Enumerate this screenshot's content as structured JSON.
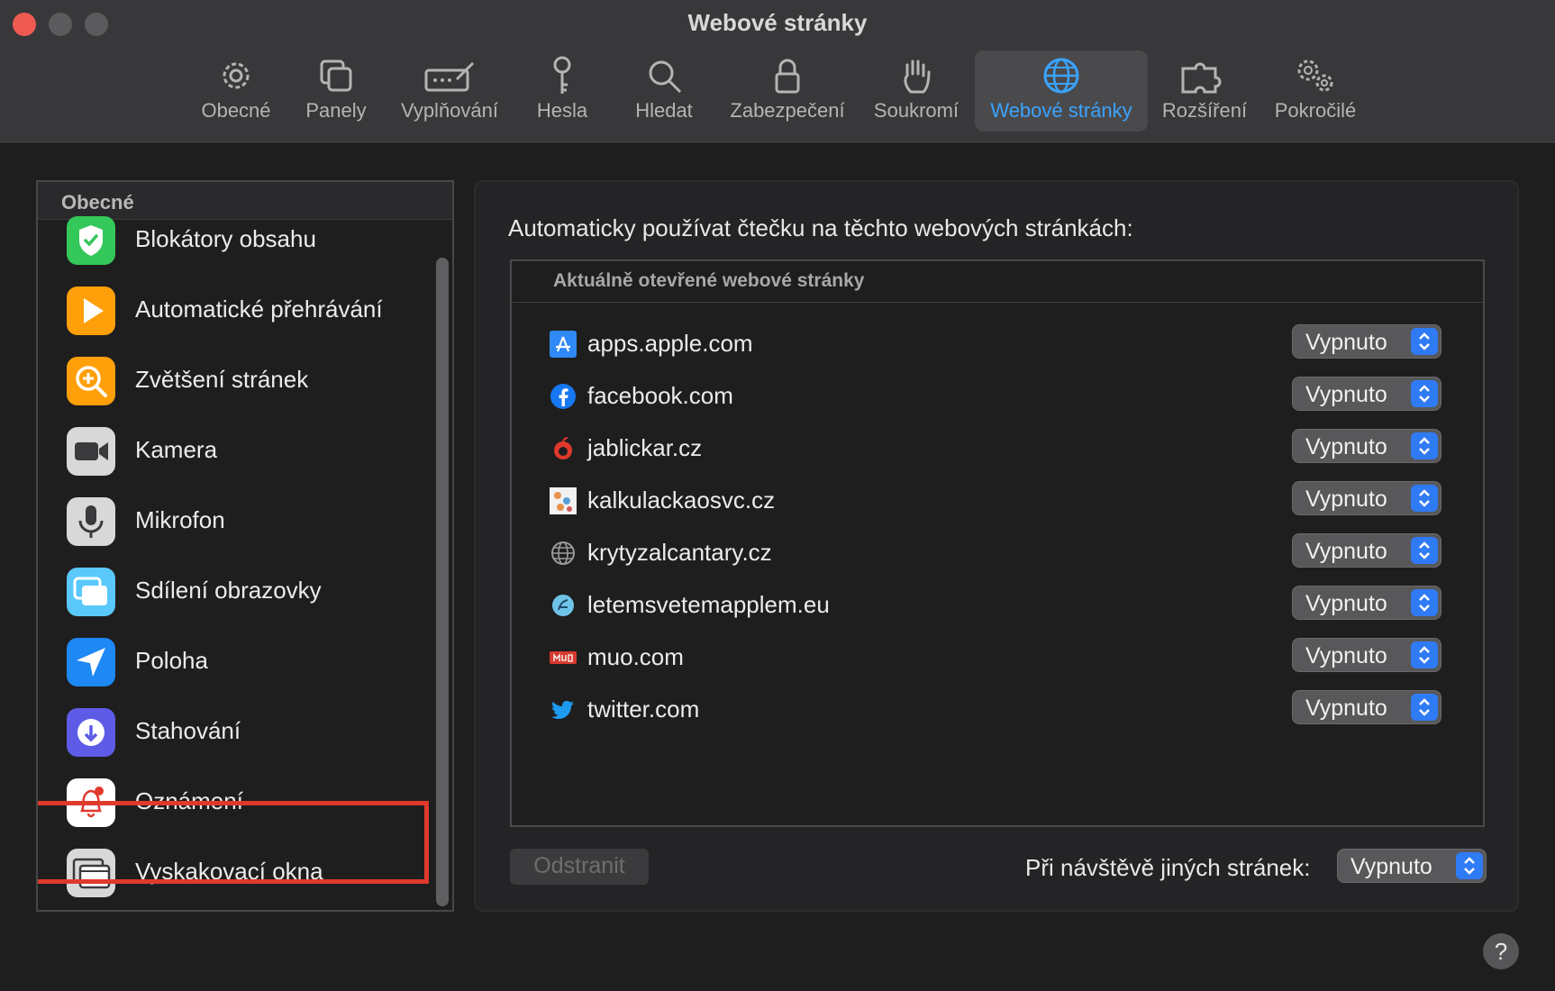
{
  "window": {
    "title": "Webové stránky"
  },
  "toolbar": {
    "tabs": [
      {
        "label": "Obecné",
        "icon": "gear-icon"
      },
      {
        "label": "Panely",
        "icon": "tabs-icon"
      },
      {
        "label": "Vyplňování",
        "icon": "autofill-icon"
      },
      {
        "label": "Hesla",
        "icon": "key-icon"
      },
      {
        "label": "Hledat",
        "icon": "magnifier-icon"
      },
      {
        "label": "Zabezpečení",
        "icon": "lock-icon"
      },
      {
        "label": "Soukromí",
        "icon": "hand-icon"
      },
      {
        "label": "Webové stránky",
        "icon": "globe-icon",
        "active": true
      },
      {
        "label": "Rozšíření",
        "icon": "puzzle-icon"
      },
      {
        "label": "Pokročilé",
        "icon": "gears-icon"
      }
    ],
    "active_color": "#3aa3ff"
  },
  "sidebar": {
    "header": "Obecné",
    "items": [
      {
        "label": "Blokátory obsahu",
        "icon": "content-blocker-icon",
        "color": "#34c759"
      },
      {
        "label": "Automatické přehrávání",
        "icon": "autoplay-icon",
        "color": "#ff9f0a"
      },
      {
        "label": "Zvětšení stránek",
        "icon": "page-zoom-icon",
        "color": "#ff9f0a"
      },
      {
        "label": "Kamera",
        "icon": "camera-icon",
        "color": "#8e8e93"
      },
      {
        "label": "Mikrofon",
        "icon": "microphone-icon",
        "color": "#8e8e93"
      },
      {
        "label": "Sdílení obrazovky",
        "icon": "screen-sharing-icon",
        "color": "#5ac8fa"
      },
      {
        "label": "Poloha",
        "icon": "location-icon",
        "color": "#1e88f5"
      },
      {
        "label": "Stahování",
        "icon": "downloads-icon",
        "color": "#5e5ce6"
      },
      {
        "label": "Oznámení",
        "icon": "notifications-icon",
        "color": "#ffffff",
        "highlighted": true
      },
      {
        "label": "Vyskakovací okna",
        "icon": "popup-windows-icon",
        "color": "#8e8e93"
      }
    ],
    "highlight_color": "#e0392c"
  },
  "main": {
    "title": "Automaticky používat čtečku na těchto webových stránkách:",
    "table_header": "Aktuálně otevřené webové stránky",
    "sites": [
      {
        "name": "apps.apple.com",
        "icon": "app-store-icon",
        "value": "Vypnuto"
      },
      {
        "name": "facebook.com",
        "icon": "facebook-icon",
        "value": "Vypnuto"
      },
      {
        "name": "jablickar.cz",
        "icon": "jablickar-icon",
        "value": "Vypnuto"
      },
      {
        "name": "kalkulackaosvc.cz",
        "icon": "kalkulacka-icon",
        "value": "Vypnuto"
      },
      {
        "name": "krytyzalcantary.cz",
        "icon": "globe-icon",
        "value": "Vypnuto"
      },
      {
        "name": "letemsvetemapplem.eu",
        "icon": "letemsvetem-icon",
        "value": "Vypnuto"
      },
      {
        "name": "muo.com",
        "icon": "muo-icon",
        "value": "Vypnuto"
      },
      {
        "name": "twitter.com",
        "icon": "twitter-icon",
        "value": "Vypnuto"
      }
    ],
    "remove_button": "Odstranit",
    "other_sites_label": "Při návštěvě jiných stránek:",
    "other_sites_value": "Vypnuto"
  },
  "help": "?"
}
